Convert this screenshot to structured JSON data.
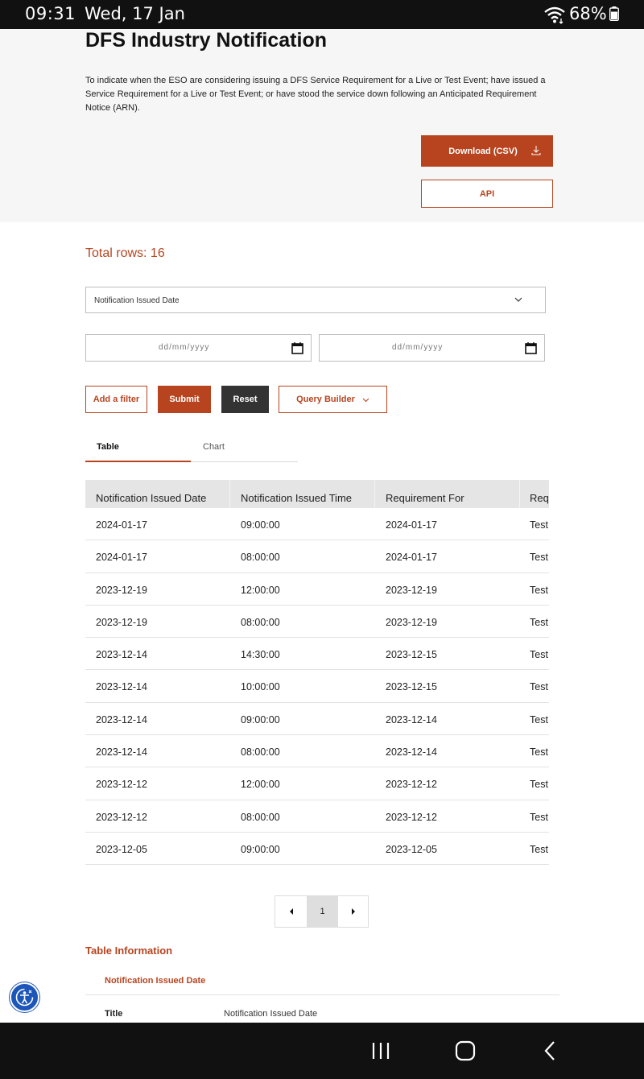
{
  "status_bar": {
    "time": "09:31",
    "date": "Wed, 17 Jan",
    "battery": "68%"
  },
  "header": {
    "title": "DFS Industry Notification",
    "description": "To indicate when the ESO are considering issuing a DFS Service Requirement for a Live or Test Event; have issued a Service Requirement for a Live or Test Event; or have stood the service down following an Anticipated Requirement Notice (ARN).",
    "download_label": "Download (CSV)",
    "api_label": "API"
  },
  "filters": {
    "total_rows": "Total rows: 16",
    "field_select_value": "Notification Issued Date",
    "date_from_placeholder": "dd/mm/yyyy",
    "date_to_placeholder": "dd/mm/yyyy",
    "add_filter_label": "Add a filter",
    "submit_label": "Submit",
    "reset_label": "Reset",
    "query_builder_label": "Query Builder"
  },
  "tabs": [
    {
      "label": "Table",
      "active": true
    },
    {
      "label": "Chart",
      "active": false
    }
  ],
  "table": {
    "columns": [
      "Notification Issued Date",
      "Notification Issued Time",
      "Requirement For",
      "Req"
    ],
    "rows": [
      [
        "2024-01-17",
        "09:00:00",
        "2024-01-17",
        "Test"
      ],
      [
        "2024-01-17",
        "08:00:00",
        "2024-01-17",
        "Test"
      ],
      [
        "2023-12-19",
        "12:00:00",
        "2023-12-19",
        "Test"
      ],
      [
        "2023-12-19",
        "08:00:00",
        "2023-12-19",
        "Test"
      ],
      [
        "2023-12-14",
        "14:30:00",
        "2023-12-15",
        "Test"
      ],
      [
        "2023-12-14",
        "10:00:00",
        "2023-12-15",
        "Test"
      ],
      [
        "2023-12-14",
        "09:00:00",
        "2023-12-14",
        "Test"
      ],
      [
        "2023-12-14",
        "08:00:00",
        "2023-12-14",
        "Test"
      ],
      [
        "2023-12-12",
        "12:00:00",
        "2023-12-12",
        "Test"
      ],
      [
        "2023-12-12",
        "08:00:00",
        "2023-12-12",
        "Test"
      ],
      [
        "2023-12-05",
        "09:00:00",
        "2023-12-05",
        "Test"
      ]
    ]
  },
  "pagination": {
    "current_page": "1"
  },
  "table_info": {
    "title": "Table Information",
    "field_name": "Notification Issued Date",
    "key_label": "Title",
    "key_value": "Notification Issued Date"
  },
  "colors": {
    "accent": "#b7441f",
    "dark_button": "#333333",
    "accessibility": "#1c56b8"
  },
  "icons": {
    "download": "download-icon",
    "chevron": "chevron-down-icon",
    "calendar": "calendar-icon",
    "prev": "caret-left-icon",
    "next": "caret-right-icon",
    "accessibility": "accessibility-icon"
  }
}
